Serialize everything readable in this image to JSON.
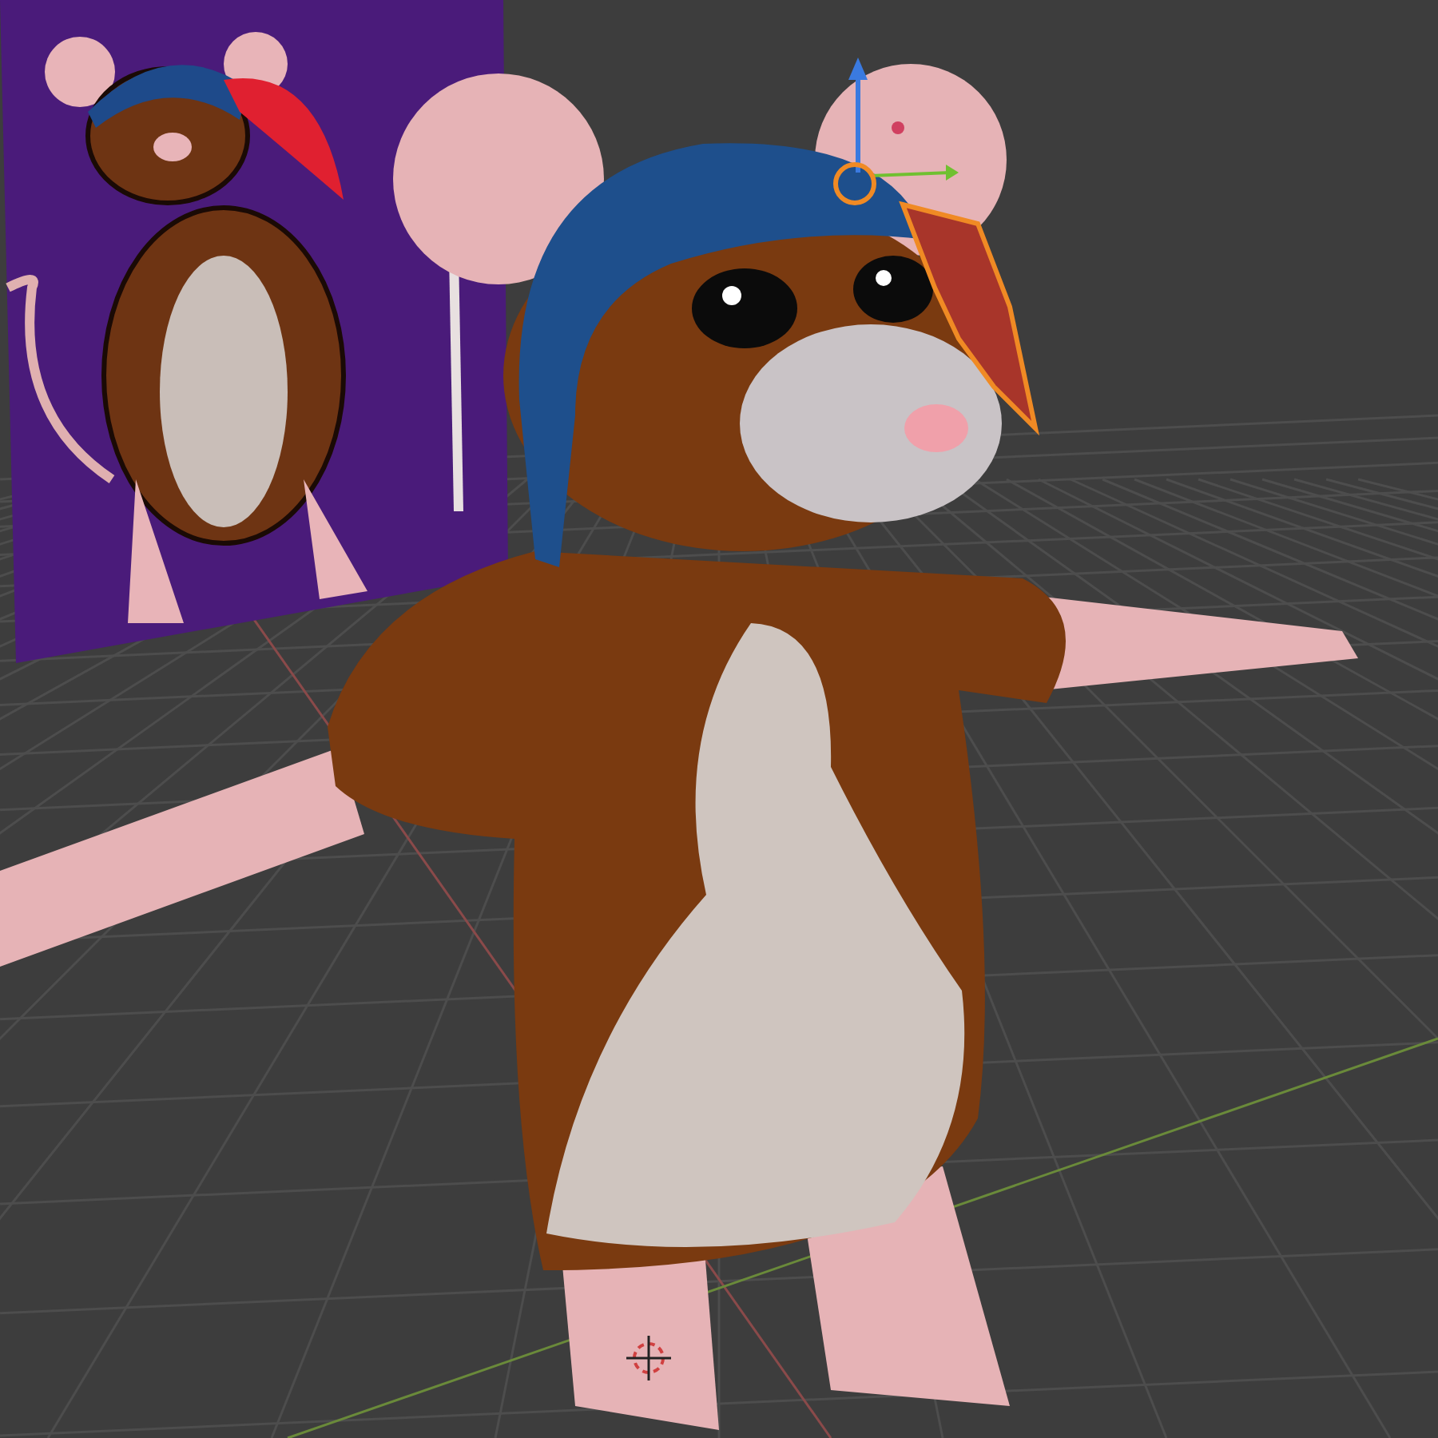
{
  "viewport": {
    "objects": [
      {
        "kind": "reference-image",
        "selected": false
      },
      {
        "kind": "mouse-model",
        "selected": false
      },
      {
        "kind": "feather",
        "selected": true
      }
    ]
  }
}
